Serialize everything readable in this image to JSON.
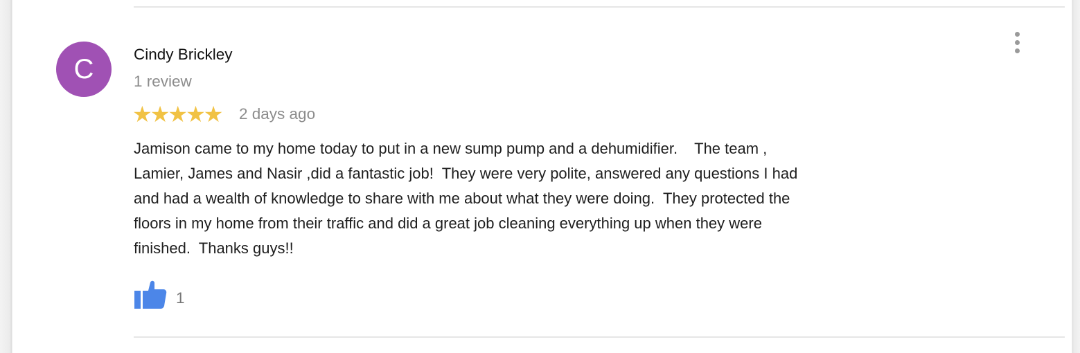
{
  "reviewer": {
    "initial": "C",
    "name": "Cindy Brickley",
    "review_count": "1 review",
    "avatar_color": "#a051b4"
  },
  "review": {
    "rating": 5,
    "stars": [
      "★",
      "★",
      "★",
      "★",
      "★"
    ],
    "star_color": "#f1c244",
    "date": "2 days ago",
    "text": "Jamison came to my home today to put in a new sump pump and a dehumidifier.    The team ,\nLamier, James and Nasir ,did a fantastic job!  They were very polite, answered any questions I had\nand had a wealth of knowledge to share with me about what they were doing.  They protected the\nfloors in my home from their traffic and did a great job cleaning everything up when they were\nfinished.  Thanks guys!!"
  },
  "actions": {
    "like_icon": "thumbs-up-icon",
    "like_count": "1",
    "like_color": "#4c86e8",
    "more_icon": "more-vertical-icon"
  }
}
